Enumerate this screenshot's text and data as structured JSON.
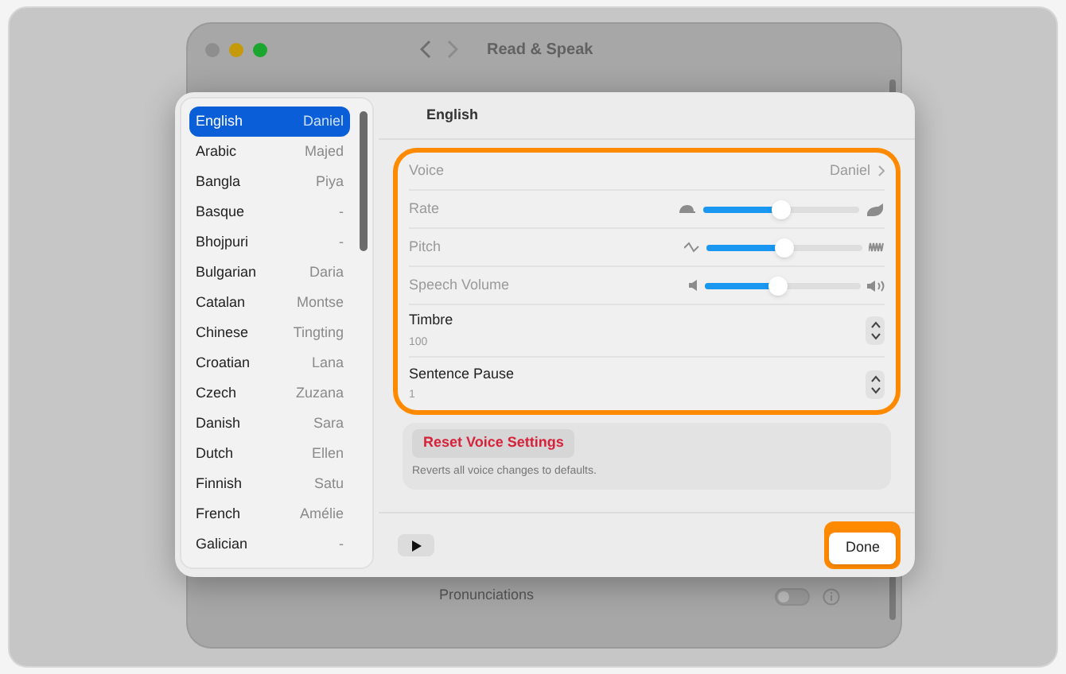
{
  "background_window": {
    "title": "Read & Speak",
    "rows": [
      {
        "label": "Pronunciations",
        "on": false
      }
    ]
  },
  "languages": [
    {
      "name": "English",
      "voice": "Daniel",
      "selected": true
    },
    {
      "name": "Arabic",
      "voice": "Majed",
      "selected": false
    },
    {
      "name": "Bangla",
      "voice": "Piya",
      "selected": false
    },
    {
      "name": "Basque",
      "voice": "-",
      "selected": false
    },
    {
      "name": "Bhojpuri",
      "voice": "-",
      "selected": false
    },
    {
      "name": "Bulgarian",
      "voice": "Daria",
      "selected": false
    },
    {
      "name": "Catalan",
      "voice": "Montse",
      "selected": false
    },
    {
      "name": "Chinese",
      "voice": "Tingting",
      "selected": false
    },
    {
      "name": "Croatian",
      "voice": "Lana",
      "selected": false
    },
    {
      "name": "Czech",
      "voice": "Zuzana",
      "selected": false
    },
    {
      "name": "Danish",
      "voice": "Sara",
      "selected": false
    },
    {
      "name": "Dutch",
      "voice": "Ellen",
      "selected": false
    },
    {
      "name": "Finnish",
      "voice": "Satu",
      "selected": false
    },
    {
      "name": "French",
      "voice": "Amélie",
      "selected": false
    },
    {
      "name": "Galician",
      "voice": "-",
      "selected": false
    }
  ],
  "detail": {
    "title": "English",
    "highlighted": true,
    "settings": [
      {
        "kind": "voice",
        "label": "Voice",
        "value": "Daniel",
        "disabled": true
      },
      {
        "kind": "rate",
        "label": "Rate",
        "level": 0.5,
        "disabled": true
      },
      {
        "kind": "pitch",
        "label": "Pitch",
        "level": 0.5,
        "disabled": true
      },
      {
        "kind": "volume",
        "label": "Speech Volume",
        "level": 0.47,
        "disabled": true
      },
      {
        "kind": "stepper",
        "label": "Timbre",
        "value": "100",
        "disabled": false
      },
      {
        "kind": "stepper",
        "label": "Sentence Pause",
        "value": "1",
        "disabled": false
      }
    ],
    "reset": {
      "button": "Reset Voice Settings",
      "description": "Reverts all voice changes to defaults."
    }
  },
  "footer": {
    "done": {
      "label": "Done",
      "highlighted": true
    }
  }
}
